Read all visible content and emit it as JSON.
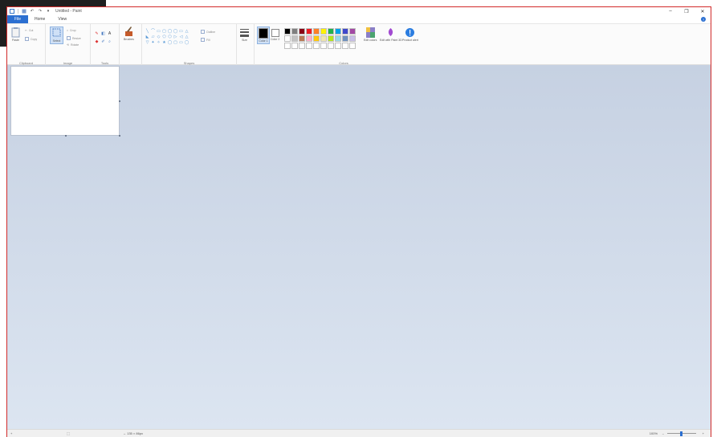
{
  "window": {
    "title": "Untitled - Paint",
    "qat": [
      "save",
      "undo",
      "redo",
      "customize"
    ],
    "controls": {
      "minimize": "–",
      "maximize": "❐",
      "close": "✕"
    }
  },
  "tabs": [
    {
      "label": "File",
      "active": true
    },
    {
      "label": "Home",
      "active": false
    },
    {
      "label": "View",
      "active": false
    }
  ],
  "help_glyph": "?",
  "ribbon": {
    "clipboard": {
      "label": "Clipboard",
      "paste": "Paste",
      "cut": "Cut",
      "copy": "Copy"
    },
    "image": {
      "label": "Image",
      "select": "Select",
      "crop": "Crop",
      "resize": "Resize",
      "rotate": "Rotate"
    },
    "tools": {
      "label": "Tools",
      "brushes": "Brushes",
      "icons": [
        "pencil-icon",
        "fill-icon",
        "text-icon",
        "eraser-icon",
        "color-picker-icon",
        "magnifier-icon"
      ]
    },
    "shapes": {
      "label": "Shapes",
      "outline": "Outline",
      "fill": "Fill",
      "glyphs": [
        "╲",
        "⌒",
        "▭",
        "▢",
        "◯",
        "◯",
        "▭",
        "△",
        "◣",
        "▱",
        "◇",
        "⬠",
        "⬡",
        "▷",
        "◁",
        "△",
        "▽",
        "✦",
        "✧",
        "★",
        "◯",
        "▢",
        "▭",
        "◯"
      ]
    },
    "size": {
      "label": "Size"
    },
    "colors": {
      "label": "Colors",
      "color1": "Color 1",
      "color2": "Color 2",
      "edit": "Edit colors",
      "paint3d": "Edit with Paint 3D",
      "alert": "Product alert",
      "color1_value": "#000000",
      "color2_value": "#ffffff",
      "palette": [
        "#000000",
        "#7f7f7f",
        "#880015",
        "#ed1c24",
        "#ff7f27",
        "#fff200",
        "#22b14c",
        "#00a2e8",
        "#3f48cc",
        "#a349a4",
        "#ffffff",
        "#c3c3c3",
        "#b97a57",
        "#ffaec9",
        "#ffc90e",
        "#efe4b0",
        "#b5e61d",
        "#99d9ea",
        "#7092be",
        "#c8bfe7",
        "#ffffff",
        "#ffffff",
        "#ffffff",
        "#ffffff",
        "#ffffff",
        "#ffffff",
        "#ffffff",
        "#ffffff",
        "#ffffff",
        "#ffffff"
      ]
    }
  },
  "status": {
    "add": "+",
    "selection": "⬚",
    "size": "↔ 135 × 86px",
    "zoom": "100%",
    "zoom_out": "–",
    "zoom_in": "+"
  }
}
